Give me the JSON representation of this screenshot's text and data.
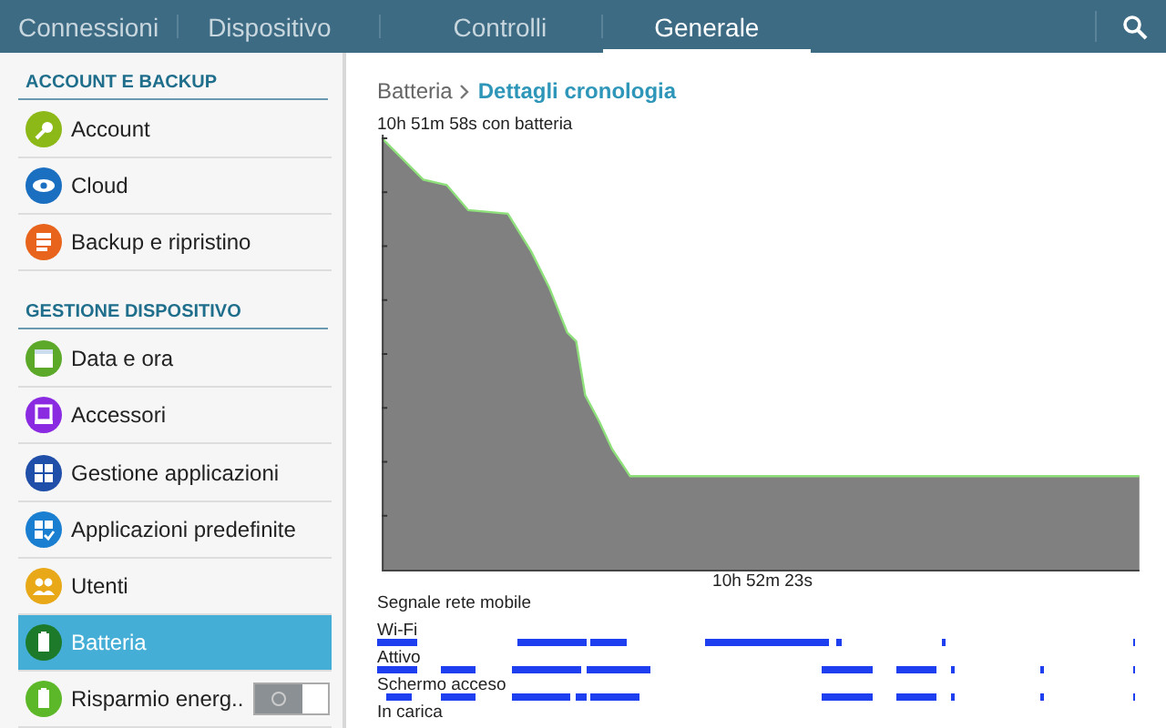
{
  "tabs": [
    {
      "label": "Connessioni",
      "selected": false
    },
    {
      "label": "Dispositivo",
      "selected": false
    },
    {
      "label": "Controlli",
      "selected": false
    },
    {
      "label": "Generale",
      "selected": true
    }
  ],
  "sidebar": {
    "sections": [
      {
        "title": "ACCOUNT E BACKUP",
        "items": [
          {
            "label": "Account",
            "kind": "key",
            "color": "#8cb818",
            "selected": false
          },
          {
            "label": "Cloud",
            "kind": "eye",
            "color": "#1a6fc0",
            "selected": false
          },
          {
            "label": "Backup e ripristino",
            "kind": "stack",
            "color": "#e8641c",
            "selected": false
          }
        ]
      },
      {
        "title": "GESTIONE DISPOSITIVO",
        "items": [
          {
            "label": "Data e ora",
            "kind": "calendar",
            "color": "#5ca828",
            "selected": false
          },
          {
            "label": "Accessori",
            "kind": "device",
            "color": "#8a2be2",
            "selected": false
          },
          {
            "label": "Gestione applicazioni",
            "kind": "grid",
            "color": "#1f4fa8",
            "selected": false
          },
          {
            "label": "Applicazioni predefinite",
            "kind": "gridcheck",
            "color": "#1a7fd0",
            "selected": false
          },
          {
            "label": "Utenti",
            "kind": "users",
            "color": "#e8a818",
            "selected": false
          },
          {
            "label": "Batteria",
            "kind": "battery",
            "color": "#1d7a2a",
            "selected": true
          },
          {
            "label": "Risparmio energ..",
            "kind": "toggle",
            "color": "#5cb828",
            "selected": false,
            "on": false
          }
        ]
      }
    ]
  },
  "breadcrumb": {
    "parent": "Batteria",
    "current": "Dettagli cronologia"
  },
  "chart_caption": "10h 51m 58s con batteria",
  "time_label": "10h 52m 23s",
  "activity_rows": [
    "Segnale rete mobile",
    "Wi-Fi",
    "Attivo",
    "Schermo acceso",
    "In carica"
  ]
}
